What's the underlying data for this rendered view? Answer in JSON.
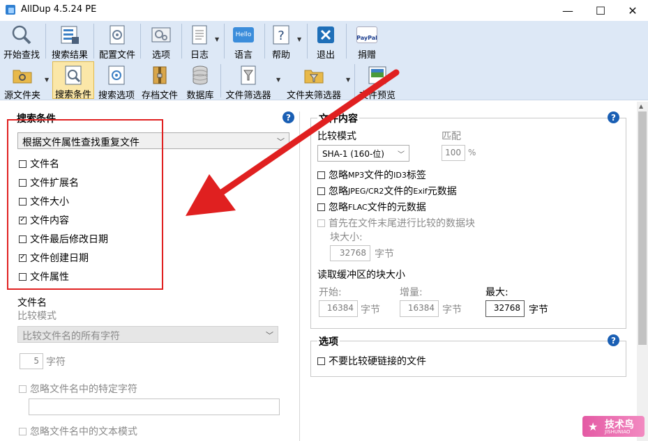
{
  "window": {
    "title": "AllDup 4.5.24 PE",
    "minimize": "—",
    "maximize": "☐",
    "close": "✕"
  },
  "toolbar1": [
    {
      "label": "开始查找",
      "icon": "magnifier-icon"
    },
    {
      "label": "搜索结果",
      "icon": "results-icon"
    },
    {
      "label": "配置文件",
      "icon": "profile-icon"
    },
    {
      "label": "选项",
      "icon": "options-icon"
    },
    {
      "label": "日志",
      "icon": "log-icon"
    },
    {
      "label": "语言",
      "icon": "hello-icon",
      "text": "Hello"
    },
    {
      "label": "帮助",
      "icon": "help-icon"
    },
    {
      "label": "退出",
      "icon": "exit-icon"
    },
    {
      "label": "捐赠",
      "icon": "paypal-icon",
      "text": "PayPal"
    }
  ],
  "toolbar2": [
    {
      "label": "源文件夹",
      "icon": "source-folder-icon"
    },
    {
      "label": "搜索条件",
      "icon": "search-criteria-icon"
    },
    {
      "label": "搜索选项",
      "icon": "search-options-icon"
    },
    {
      "label": "存档文件",
      "icon": "archive-icon"
    },
    {
      "label": "数据库",
      "icon": "database-icon"
    },
    {
      "label": "文件筛选器",
      "icon": "file-filter-icon"
    },
    {
      "label": "文件夹筛选器",
      "icon": "folder-filter-icon"
    },
    {
      "label": "文件预览",
      "icon": "file-preview-icon"
    }
  ],
  "criteria": {
    "title": "搜索条件",
    "method": "根据文件属性查找重复文件",
    "items": [
      {
        "label": "文件名",
        "checked": false
      },
      {
        "label": "文件扩展名",
        "checked": false
      },
      {
        "label": "文件大小",
        "checked": false
      },
      {
        "label": "文件内容",
        "checked": true
      },
      {
        "label": "文件最后修改日期",
        "checked": false
      },
      {
        "label": "文件创建日期",
        "checked": true
      },
      {
        "label": "文件属性",
        "checked": false
      }
    ]
  },
  "filename": {
    "title": "文件名",
    "compare_mode_label": "比较模式",
    "compare_mode": "比较文件名的所有字符",
    "chars_value": "5",
    "chars_unit": "字符",
    "ignore_chars": "忽略文件名中的特定字符",
    "ignore_pattern": "忽略文件名中的文本模式"
  },
  "content": {
    "title": "文件内容",
    "compare_mode_label": "比较模式",
    "compare_mode": "SHA-1 (160-位)",
    "match_label": "匹配",
    "match_value": "100",
    "match_unit": "%",
    "ignore_mp3_a": "忽略 ",
    "ignore_mp3_b": "MP3",
    "ignore_mp3_c": " 文件的 ",
    "ignore_mp3_d": "ID3",
    "ignore_mp3_e": " 标签",
    "ignore_jpeg_a": "忽略 ",
    "ignore_jpeg_b": "JPEG/CR2",
    "ignore_jpeg_c": " 文件的 ",
    "ignore_jpeg_d": "Exif",
    "ignore_jpeg_e": " 元数据",
    "ignore_flac_a": "忽略 ",
    "ignore_flac_b": "FLAC",
    "ignore_flac_c": " 文件的元数据",
    "compare_end_first": "首先在文件末尾进行比较的数据块",
    "block_size_label": "块大小:",
    "block_size_value": "32768",
    "byte_unit": "字节",
    "buffer_title": "读取缓冲区的块大小",
    "start_label": "开始:",
    "start_value": "16384",
    "increment_label": "增量:",
    "increment_value": "16384",
    "max_label": "最大:",
    "max_value": "32768"
  },
  "options": {
    "title": "选项",
    "no_hardlinks": "不要比较硬链接的文件"
  },
  "help_glyph": "?",
  "watermark": {
    "main": "技术鸟",
    "sub": "JISHUNIAO"
  },
  "colors": {
    "accent": "#1a5fb4",
    "highlight": "#e02020",
    "toolbar": "#dde8f6"
  }
}
